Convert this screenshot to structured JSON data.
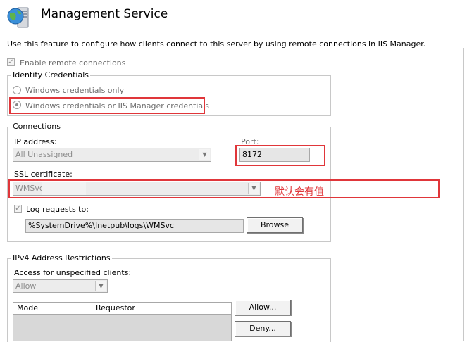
{
  "header": {
    "title": "Management Service",
    "icon": "globe-server-icon",
    "description": "Use this feature to configure how clients connect to this server by using remote connections in IIS Manager."
  },
  "remote": {
    "enable_label": "Enable remote connections",
    "checked": true
  },
  "identity": {
    "legend": "Identity Credentials",
    "options": [
      "Windows credentials only",
      "Windows credentials or IIS Manager credentials"
    ],
    "selected_index": 1
  },
  "connections": {
    "legend": "Connections",
    "ip_label": "IP address:",
    "ip_value": "All Unassigned",
    "port_label": "Port:",
    "port_value": "8172",
    "ssl_label": "SSL certificate:",
    "ssl_value": "WMSvc",
    "annotation": "默认会有值",
    "log_label": "Log requests to:",
    "log_checked": true,
    "log_path": "%SystemDrive%\\Inetpub\\logs\\WMSvc",
    "browse_label": "Browse"
  },
  "ipv4": {
    "legend": "IPv4 Address Restrictions",
    "access_label": "Access for unspecified clients:",
    "access_value": "Allow",
    "columns": [
      "Mode",
      "Requestor"
    ],
    "allow_label": "Allow...",
    "deny_label": "Deny..."
  },
  "colors": {
    "highlight": "#e0363a",
    "border": "#c8c8c8",
    "disabled_text": "#8c8c8c"
  }
}
